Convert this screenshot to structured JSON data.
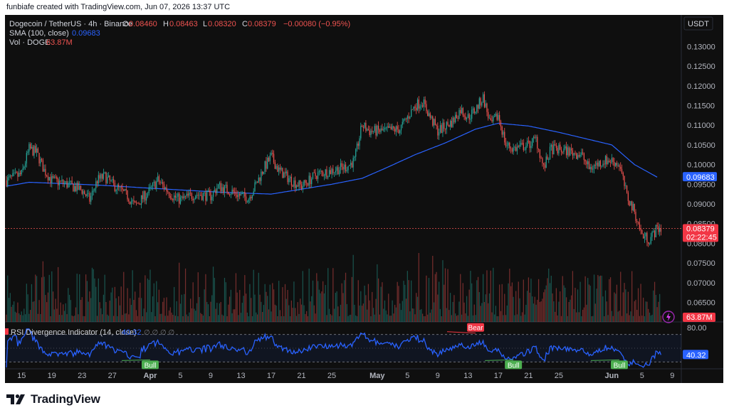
{
  "header": {
    "credit": "funbiafe created with TradingView.com, Jun 07, 2026 13:37 UTC"
  },
  "legend": {
    "symbol": "Dogecoin / TetherUS · 4h · Binance",
    "o_label": "O",
    "o": "0.08460",
    "h_label": "H",
    "h": "0.08463",
    "l_label": "L",
    "l": "0.08320",
    "c_label": "C",
    "c": "0.08379",
    "change": "−0.00080 (−0.95%)",
    "sma_label": "SMA (100, close)",
    "sma_value": "0.09683",
    "vol_label": "Vol · DOGE",
    "vol_value": "63.87M"
  },
  "price_axis": {
    "currency": "USDT",
    "ticks": [
      "0.13000",
      "0.12500",
      "0.12000",
      "0.11500",
      "0.11000",
      "0.10500",
      "0.10000",
      "0.09500",
      "0.09000",
      "0.08500",
      "0.08000",
      "0.07500",
      "0.07000",
      "0.06500"
    ],
    "sma_badge": "0.09683",
    "price_badge": "0.08379",
    "countdown": "02:22:45",
    "vol_badge": "63.87M"
  },
  "rsi": {
    "label": "RSI Divergence Indicator (14, close)",
    "value": "40.32",
    "placeholders": "∅ ∅ ∅ ∅",
    "axis_top": "80.00",
    "badge": "40.32",
    "bull_label": "Bull",
    "bear_label": "Bear"
  },
  "time_axis": [
    "15",
    "19",
    "23",
    "27",
    "Apr",
    "5",
    "9",
    "13",
    "17",
    "21",
    "25",
    "May",
    "5",
    "9",
    "13",
    "17",
    "21",
    "25",
    "Jun",
    "5",
    "9"
  ],
  "footer": {
    "brand": "TradingView"
  },
  "colors": {
    "up": "#26a69a",
    "down": "#ef5350",
    "sma": "#2962ff",
    "rsi": "#2962ff",
    "bull": "#4caf50",
    "bear": "#f23645"
  },
  "chart_data": {
    "type": "candlestick",
    "title": "Dogecoin / TetherUS · 4h · Binance",
    "y_axis": {
      "unit": "USDT",
      "range": [
        0.064,
        0.1335
      ]
    },
    "price_path_close": [
      [
        "Mar 13",
        0.096
      ],
      [
        "Mar 15",
        0.0975
      ],
      [
        "Mar 16",
        0.104
      ],
      [
        "Mar 17",
        0.103
      ],
      [
        "Mar 18",
        0.0985
      ],
      [
        "Mar 19",
        0.096
      ],
      [
        "Mar 21",
        0.095
      ],
      [
        "Mar 23",
        0.0935
      ],
      [
        "Mar 24",
        0.091
      ],
      [
        "Mar 25",
        0.096
      ],
      [
        "Mar 26",
        0.097
      ],
      [
        "Mar 27",
        0.095
      ],
      [
        "Mar 29",
        0.092
      ],
      [
        "Mar 30",
        0.0895
      ],
      [
        "Apr 1",
        0.0935
      ],
      [
        "Apr 2",
        0.096
      ],
      [
        "Apr 4",
        0.092
      ],
      [
        "Apr 5",
        0.091
      ],
      [
        "Apr 7",
        0.0925
      ],
      [
        "Apr 9",
        0.092
      ],
      [
        "Apr 10",
        0.0945
      ],
      [
        "Apr 12",
        0.093
      ],
      [
        "Apr 13",
        0.092
      ],
      [
        "Apr 14",
        0.0915
      ],
      [
        "Apr 15",
        0.095
      ],
      [
        "Apr 16",
        0.099
      ],
      [
        "Apr 17",
        0.102
      ],
      [
        "Apr 18",
        0.0985
      ],
      [
        "Apr 20",
        0.0955
      ],
      [
        "Apr 21",
        0.0945
      ],
      [
        "Apr 23",
        0.0975
      ],
      [
        "Apr 25",
        0.0985
      ],
      [
        "Apr 27",
        0.0995
      ],
      [
        "Apr 28",
        0.101
      ],
      [
        "Apr 29",
        0.11
      ],
      [
        "Apr 30",
        0.1085
      ],
      [
        "May 2",
        0.1085
      ],
      [
        "May 4",
        0.109
      ],
      [
        "May 6",
        0.115
      ],
      [
        "May 7",
        0.116
      ],
      [
        "May 8",
        0.112
      ],
      [
        "May 9",
        0.1085
      ],
      [
        "May 11",
        0.111
      ],
      [
        "May 12",
        0.114
      ],
      [
        "May 13",
        0.112
      ],
      [
        "May 14",
        0.114
      ],
      [
        "May 15",
        0.117
      ],
      [
        "May 16",
        0.11
      ],
      [
        "May 17",
        0.1125
      ],
      [
        "May 18",
        0.105
      ],
      [
        "May 19",
        0.104
      ],
      [
        "May 21",
        0.105
      ],
      [
        "May 22",
        0.1065
      ],
      [
        "May 23",
        0.099
      ],
      [
        "May 24",
        0.104
      ],
      [
        "May 26",
        0.1035
      ],
      [
        "May 28",
        0.1025
      ],
      [
        "May 29",
        0.099
      ],
      [
        "May 31",
        0.101
      ],
      [
        "Jun 1",
        0.101
      ],
      [
        "Jun 2",
        0.1
      ],
      [
        "Jun 3",
        0.092
      ],
      [
        "Jun 4",
        0.088
      ],
      [
        "Jun 5",
        0.082
      ],
      [
        "Jun 6",
        0.081
      ],
      [
        "Jun 7",
        0.0838
      ]
    ],
    "sma_100": [
      [
        "Mar 13",
        0.0945
      ],
      [
        "Mar 16",
        0.0955
      ],
      [
        "Mar 25",
        0.0948
      ],
      [
        "Apr 1",
        0.094
      ],
      [
        "Apr 10",
        0.093
      ],
      [
        "Apr 17",
        0.0925
      ],
      [
        "Apr 25",
        0.095
      ],
      [
        "Apr 29",
        0.0965
      ],
      [
        "May 2",
        0.099
      ],
      [
        "May 6",
        0.1025
      ],
      [
        "May 10",
        0.1055
      ],
      [
        "May 14",
        0.109
      ],
      [
        "May 17",
        0.1105
      ],
      [
        "May 21",
        0.1098
      ],
      [
        "May 25",
        0.1082
      ],
      [
        "Jun 1",
        0.105
      ],
      [
        "Jun 4",
        0.1
      ],
      [
        "Jun 7",
        0.0968
      ]
    ],
    "rsi_range": [
      20,
      80
    ],
    "rsi_last": 40.32,
    "rsi_band": [
      30,
      70
    ],
    "divergence_markers": [
      {
        "label": "Bull",
        "date": "Apr 1"
      },
      {
        "label": "Bear",
        "date": "May 14"
      },
      {
        "label": "Bull",
        "date": "May 19"
      },
      {
        "label": "Bull",
        "date": "Jun 2"
      }
    ]
  }
}
